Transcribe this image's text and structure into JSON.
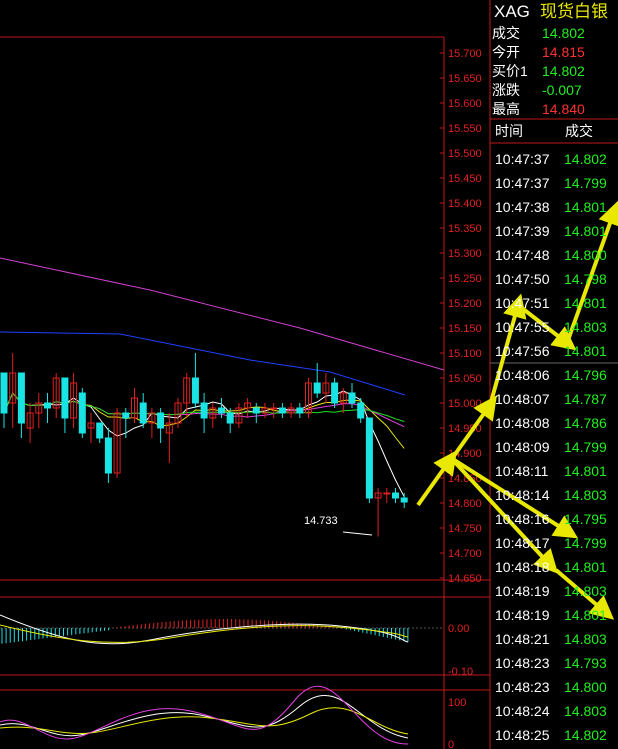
{
  "instrument": {
    "code": "XAG",
    "name": "现货白银"
  },
  "colors": {
    "up": "#e02020",
    "down": "#19e3e3",
    "grid": "#c01818",
    "accent": "#e8e800",
    "green": "#22ee22",
    "red": "#ff3030"
  },
  "quote": [
    {
      "key": "成交",
      "value": "14.802",
      "color": "green"
    },
    {
      "key": "今开",
      "value": "14.815",
      "color": "red"
    },
    {
      "key": "买价1",
      "value": "14.802",
      "color": "green"
    },
    {
      "key": "涨跌",
      "value": "-0.007",
      "color": "green"
    },
    {
      "key": "最高",
      "value": "14.840",
      "color": "red"
    }
  ],
  "ticks_header": {
    "time": "时间",
    "price": "成交"
  },
  "ticks": [
    {
      "time": "10:47:37",
      "price": "14.802"
    },
    {
      "time": "10:47:37",
      "price": "14.799"
    },
    {
      "time": "10:47:38",
      "price": "14.801"
    },
    {
      "time": "10:47:39",
      "price": "14.801"
    },
    {
      "time": "10:47:48",
      "price": "14.800"
    },
    {
      "time": "10:47:50",
      "price": "14.798"
    },
    {
      "time": "10:47:51",
      "price": "14.801"
    },
    {
      "time": "10:47:55",
      "price": "14.803"
    },
    {
      "time": "10:47:56",
      "price": "14.801"
    },
    {
      "time": "10:48:06",
      "price": "14.796"
    },
    {
      "time": "10:48:07",
      "price": "14.787"
    },
    {
      "time": "10:48:08",
      "price": "14.786"
    },
    {
      "time": "10:48:09",
      "price": "14.799"
    },
    {
      "time": "10:48:11",
      "price": "14.801"
    },
    {
      "time": "10:48:14",
      "price": "14.803"
    },
    {
      "time": "10:48:16",
      "price": "14.795"
    },
    {
      "time": "10:48:17",
      "price": "14.799"
    },
    {
      "time": "10:48:18",
      "price": "14.801"
    },
    {
      "time": "10:48:19",
      "price": "14.803"
    },
    {
      "time": "10:48:19",
      "price": "14.801"
    },
    {
      "time": "10:48:21",
      "price": "14.803"
    },
    {
      "time": "10:48:23",
      "price": "14.793"
    },
    {
      "time": "10:48:23",
      "price": "14.800"
    },
    {
      "time": "10:48:24",
      "price": "14.803"
    },
    {
      "time": "10:48:25",
      "price": "14.802"
    }
  ],
  "price_axis": {
    "labels": [
      "15.700",
      "15.650",
      "15.600",
      "15.550",
      "15.500",
      "15.450",
      "15.400",
      "15.350",
      "15.300",
      "15.250",
      "15.200",
      "15.150",
      "15.100",
      "15.050",
      "15.000",
      "14.950",
      "14.900",
      "14.850",
      "14.800",
      "14.750",
      "14.700",
      "14.650"
    ],
    "min": 14.65,
    "max": 15.7
  },
  "low_annotation": "14.733",
  "macd_axis": {
    "labels": [
      "0.00",
      "-0.10"
    ]
  },
  "kdj_axis": {
    "labels": [
      "100",
      "0"
    ]
  },
  "chart_data": {
    "type": "candlestick",
    "ylim": [
      14.65,
      15.7
    ],
    "candles": [
      [
        15.06,
        15.06,
        14.95,
        14.98
      ],
      [
        15.0,
        15.1,
        14.95,
        15.06
      ],
      [
        15.06,
        15.06,
        14.93,
        14.96
      ],
      [
        14.95,
        15.0,
        14.92,
        14.98
      ],
      [
        14.98,
        15.02,
        14.95,
        15.0
      ],
      [
        15.0,
        15.02,
        14.96,
        14.99
      ],
      [
        14.99,
        15.06,
        14.97,
        15.05
      ],
      [
        15.05,
        15.05,
        14.94,
        14.97
      ],
      [
        14.97,
        15.06,
        14.95,
        15.04
      ],
      [
        15.02,
        15.03,
        14.93,
        14.94
      ],
      [
        14.95,
        14.98,
        14.92,
        14.96
      ],
      [
        14.96,
        14.96,
        14.92,
        14.93
      ],
      [
        14.93,
        14.95,
        14.84,
        14.86
      ],
      [
        14.86,
        14.99,
        14.85,
        14.98
      ],
      [
        14.98,
        14.99,
        14.93,
        14.97
      ],
      [
        14.97,
        15.03,
        14.96,
        15.01
      ],
      [
        15.0,
        15.02,
        14.95,
        14.96
      ],
      [
        14.96,
        14.99,
        14.93,
        14.98
      ],
      [
        14.98,
        14.99,
        14.92,
        14.95
      ],
      [
        14.94,
        14.98,
        14.88,
        14.96
      ],
      [
        14.96,
        15.01,
        14.95,
        15.0
      ],
      [
        15.0,
        15.06,
        14.97,
        15.05
      ],
      [
        15.05,
        15.1,
        14.99,
        15.0
      ],
      [
        15.0,
        15.02,
        14.94,
        14.97
      ],
      [
        14.97,
        15.0,
        14.95,
        14.99
      ],
      [
        14.99,
        15.01,
        14.97,
        14.98
      ],
      [
        14.98,
        14.99,
        14.94,
        14.96
      ],
      [
        14.96,
        15.0,
        14.95,
        14.99
      ],
      [
        14.99,
        15.01,
        14.97,
        15.0
      ],
      [
        14.99,
        15.0,
        14.96,
        14.98
      ],
      [
        14.98,
        15.0,
        14.97,
        14.99
      ],
      [
        14.99,
        15.0,
        14.97,
        14.99
      ],
      [
        14.99,
        15.0,
        14.97,
        14.98
      ],
      [
        14.98,
        15.0,
        14.97,
        14.99
      ],
      [
        14.99,
        15.0,
        14.97,
        14.98
      ],
      [
        14.98,
        15.05,
        14.97,
        15.04
      ],
      [
        15.04,
        15.08,
        15.01,
        15.02
      ],
      [
        15.02,
        15.06,
        15.0,
        15.04
      ],
      [
        15.04,
        15.05,
        14.99,
        15.0
      ],
      [
        15.0,
        15.03,
        14.98,
        15.02
      ],
      [
        15.02,
        15.04,
        14.99,
        15.0
      ],
      [
        15.0,
        15.01,
        14.96,
        14.97
      ],
      [
        14.97,
        14.97,
        14.8,
        14.81
      ],
      [
        14.81,
        14.83,
        14.733,
        14.82
      ],
      [
        14.82,
        14.83,
        14.8,
        14.82
      ],
      [
        14.82,
        14.83,
        14.8,
        14.81
      ],
      [
        14.81,
        14.82,
        14.79,
        14.802
      ]
    ]
  }
}
